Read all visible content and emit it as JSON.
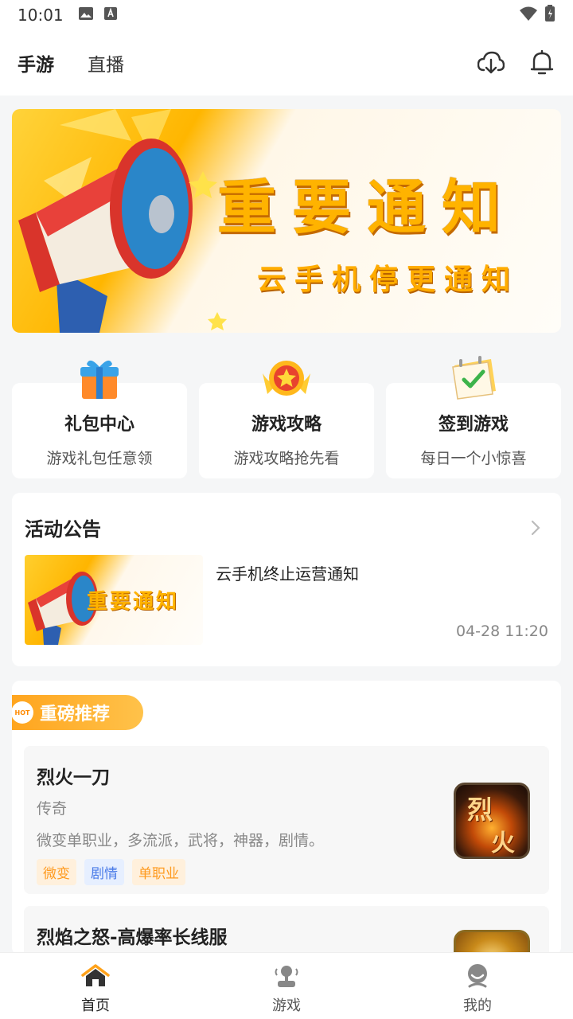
{
  "status_bar": {
    "time": "10:01"
  },
  "header": {
    "tabs": [
      {
        "label": "手游",
        "active": true
      },
      {
        "label": "直播",
        "active": false
      }
    ]
  },
  "banner": {
    "headline": "重要通知",
    "subline": "云手机停更通知"
  },
  "features": [
    {
      "title": "礼包中心",
      "desc": "游戏礼包任意领",
      "icon": "gift-icon"
    },
    {
      "title": "游戏攻略",
      "desc": "游戏攻略抢先看",
      "icon": "star-medal-icon"
    },
    {
      "title": "签到游戏",
      "desc": "每日一个小惊喜",
      "icon": "calendar-check-icon"
    }
  ],
  "announcement": {
    "title": "活动公告",
    "thumb_text": "重要通知",
    "item_title": "云手机终止运营通知",
    "time": "04-28 11:20"
  },
  "recommend": {
    "badge_hot": "HOT",
    "badge_label": "重磅推荐",
    "games": [
      {
        "name": "烈火一刀",
        "genre": "传奇",
        "desc": "微变单职业，多流派，武将，神器，剧情。",
        "tags": [
          "微变",
          "剧情",
          "单职业"
        ],
        "icon_text_1": "烈",
        "icon_text_2": "火"
      },
      {
        "name": "烈焰之怒-高爆率长线服"
      }
    ]
  },
  "bottom_nav": [
    {
      "label": "首页",
      "icon": "home-icon",
      "active": true
    },
    {
      "label": "游戏",
      "icon": "joystick-icon",
      "active": false
    },
    {
      "label": "我的",
      "icon": "profile-icon",
      "active": false
    }
  ],
  "colors": {
    "accent": "#ffb12a",
    "badge": "#ffa21a",
    "background": "#f5f6f7"
  }
}
